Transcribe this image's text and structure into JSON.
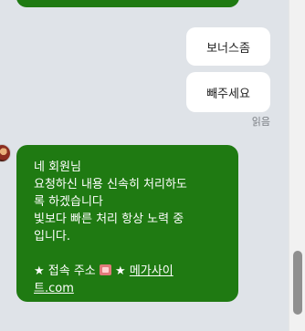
{
  "messages": {
    "outgoing": [
      {
        "text": "보너스좀"
      },
      {
        "text": "빼주세요"
      }
    ],
    "read_label": "읽음",
    "incoming": {
      "lines": [
        "네 회원님",
        "요청하신 내용 신속히 처리하도",
        "록 하겠습니다",
        "빛보다 빠른 처리 항상 노력 중",
        "입니다."
      ],
      "site_prefix": "★ 접속 주소",
      "site_star": "★",
      "link_part1": "메가사이",
      "link_part2": "트.com"
    }
  },
  "colors": {
    "incoming_bubble": "#1f7a12",
    "outgoing_bubble": "#ffffff",
    "background": "#dfe3e8"
  },
  "icons": {
    "avatar": "profile-avatar",
    "site_emoji": "building-emoji-icon"
  }
}
